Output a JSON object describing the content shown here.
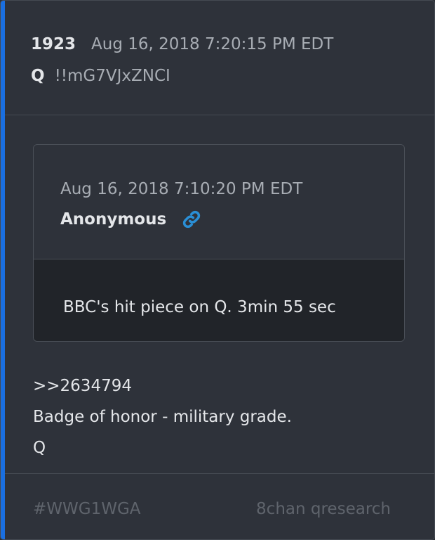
{
  "post": {
    "number": "1923",
    "date": "Aug 16, 2018 7:20:15 PM EDT",
    "author": "Q",
    "tripcode": "!!mG7VJxZNCI"
  },
  "quoted": {
    "date": "Aug 16, 2018 7:10:20 PM EDT",
    "author": "Anonymous",
    "link_icon": "link-icon",
    "text": "BBC's hit piece on Q. 3min 55 sec"
  },
  "message": {
    "lines": [
      ">>2634794",
      "Badge of honor - military grade.",
      "Q"
    ]
  },
  "footer": {
    "hashtag": "#WWG1WGA",
    "source": "8chan qresearch"
  },
  "colors": {
    "accent": "#1a6fe0",
    "link": "#2a8fd6",
    "background": "#2e323a"
  }
}
